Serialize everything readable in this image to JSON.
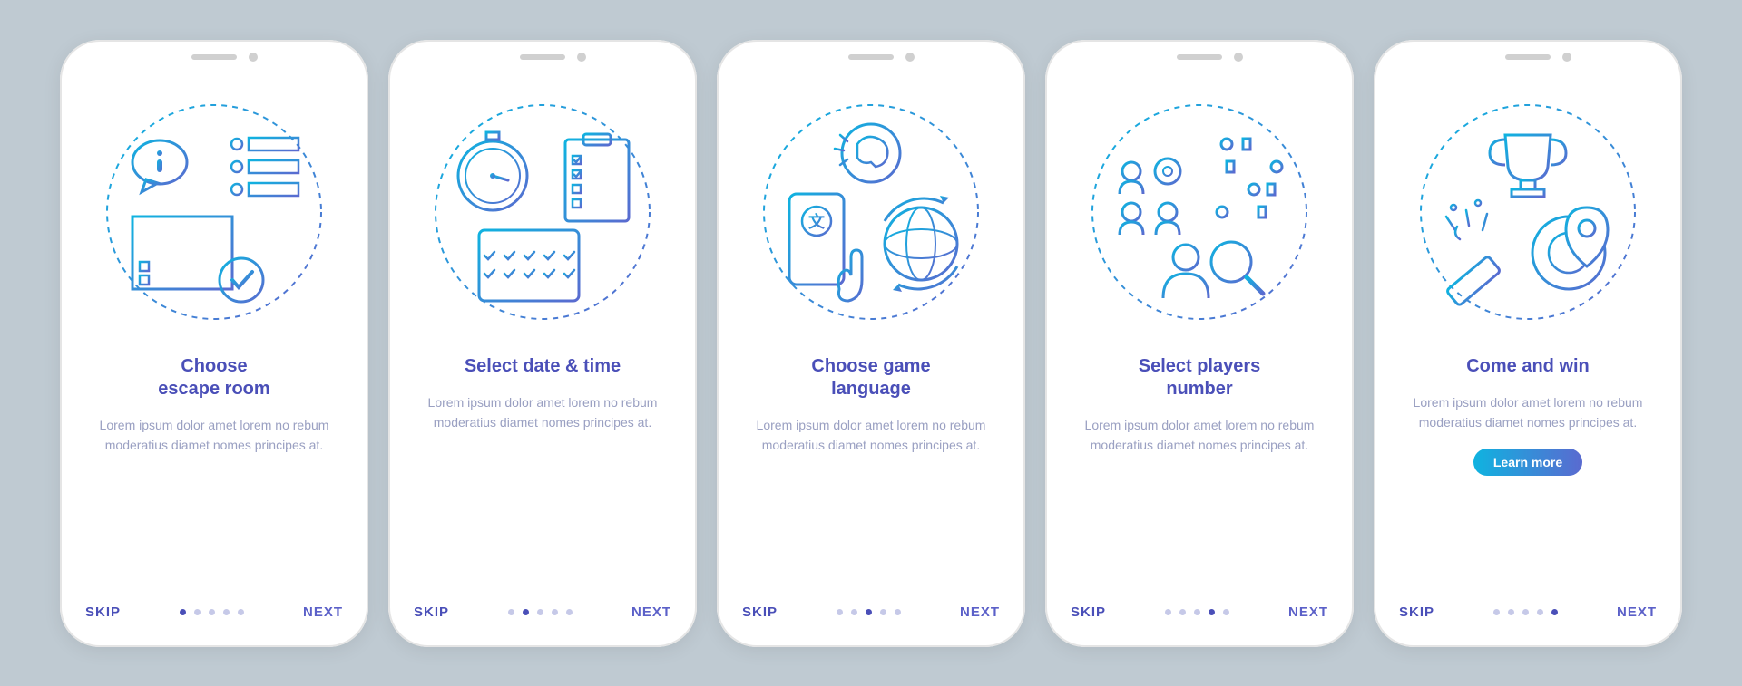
{
  "common": {
    "skip_label": "SKIP",
    "next_label": "NEXT",
    "cta_label": "Learn more",
    "total_screens": 5
  },
  "screens": [
    {
      "title": "Choose\nescape room",
      "description": "Lorem ipsum dolor amet lorem no rebum moderatius diamet nomes principes at.",
      "icon": "escape-room-icon",
      "active_dot": 0,
      "show_cta": false
    },
    {
      "title": "Select date & time",
      "description": "Lorem ipsum dolor amet lorem no rebum moderatius diamet nomes principes at.",
      "icon": "date-time-icon",
      "active_dot": 1,
      "show_cta": false
    },
    {
      "title": "Choose game\nlanguage",
      "description": "Lorem ipsum dolor amet lorem no rebum moderatius diamet nomes principes at.",
      "icon": "language-icon",
      "active_dot": 2,
      "show_cta": false
    },
    {
      "title": "Select players\nnumber",
      "description": "Lorem ipsum dolor amet lorem no rebum moderatius diamet nomes principes at.",
      "icon": "players-icon",
      "active_dot": 3,
      "show_cta": false
    },
    {
      "title": "Come and win",
      "description": "Lorem ipsum dolor amet lorem no rebum moderatius diamet nomes principes at.",
      "icon": "win-icon",
      "active_dot": 4,
      "show_cta": true
    }
  ],
  "colors": {
    "accent": "#4a4fb8",
    "gradient_start": "#0fb3e0",
    "gradient_end": "#5a6ad0",
    "text_muted": "#9aa0c2"
  }
}
